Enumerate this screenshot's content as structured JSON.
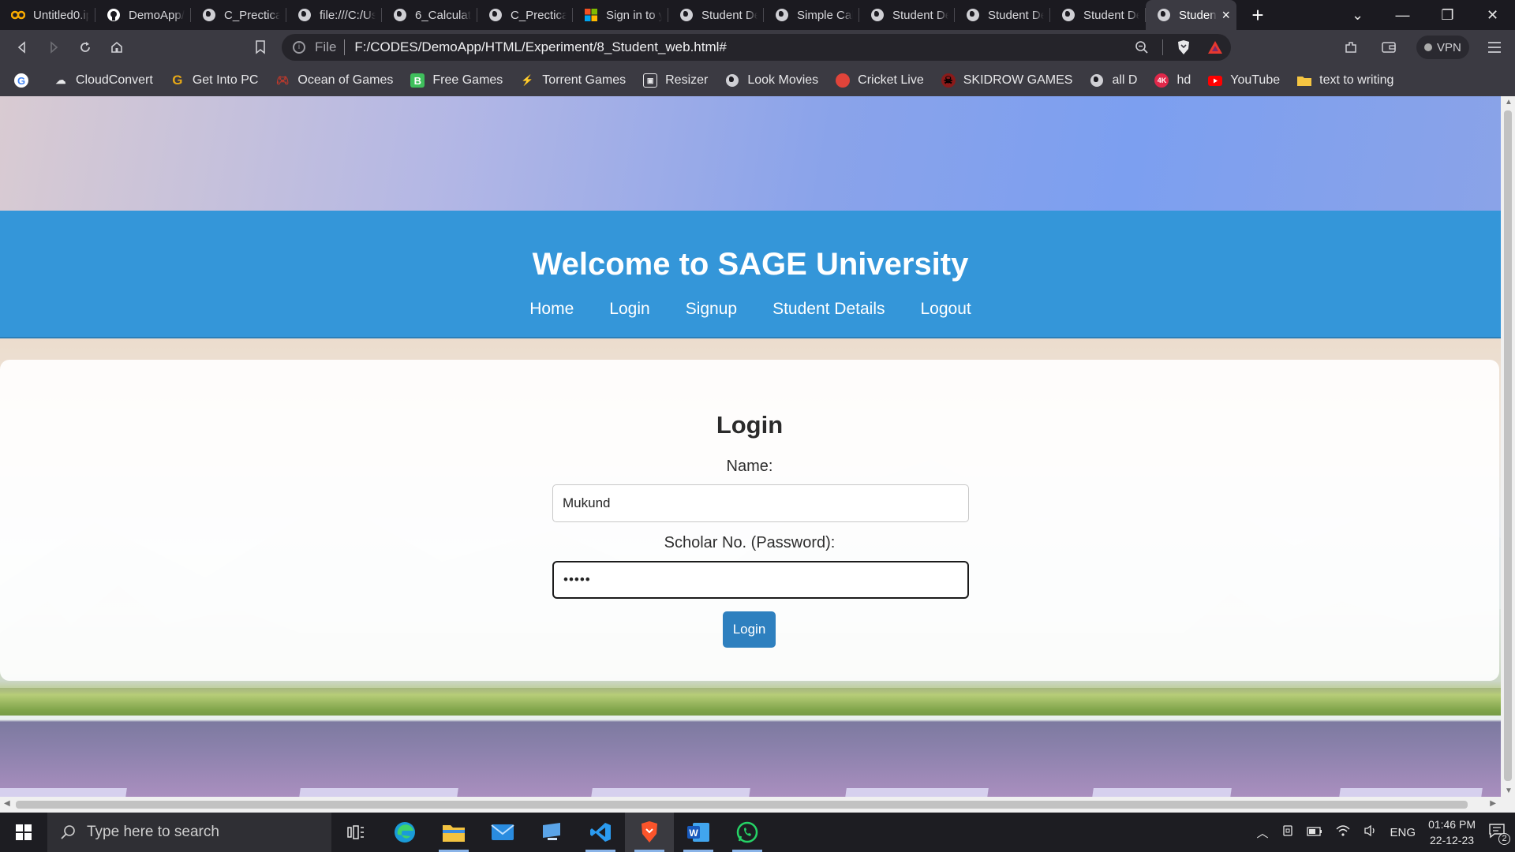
{
  "browser": {
    "tabs": [
      {
        "title": "Untitled0.ip",
        "icon": "colab-icon"
      },
      {
        "title": "DemoApp/",
        "icon": "github-icon"
      },
      {
        "title": "C_Prectical_",
        "icon": "globe-icon"
      },
      {
        "title": "file:///C:/Us",
        "icon": "globe-icon"
      },
      {
        "title": "6_Calculato",
        "icon": "globe-icon"
      },
      {
        "title": "C_Prectical_",
        "icon": "globe-icon"
      },
      {
        "title": "Sign in to y",
        "icon": "microsoft-icon"
      },
      {
        "title": "Student De",
        "icon": "globe-icon"
      },
      {
        "title": "Simple Calc",
        "icon": "globe-icon"
      },
      {
        "title": "Student De",
        "icon": "globe-icon"
      },
      {
        "title": "Student De",
        "icon": "globe-icon"
      },
      {
        "title": "Student De",
        "icon": "globe-icon"
      }
    ],
    "active_tab": {
      "title": "Studen",
      "close": "×"
    },
    "new_tab": "+",
    "address": {
      "scheme_label": "File",
      "url": "F:/CODES/DemoApp/HTML/Experiment/8_Student_web.html#"
    },
    "vpn_label": "VPN",
    "bookmarks": [
      {
        "label": "",
        "icon": "google-icon"
      },
      {
        "label": "CloudConvert",
        "icon": "cloudconvert-icon"
      },
      {
        "label": "Get Into PC",
        "icon": "getintopc-icon"
      },
      {
        "label": "Ocean of Games",
        "icon": "gamepad-icon"
      },
      {
        "label": "Free Games",
        "icon": "freegames-icon"
      },
      {
        "label": "Torrent Games",
        "icon": "torrent-icon"
      },
      {
        "label": "Resizer",
        "icon": "resizer-icon"
      },
      {
        "label": "Look Movies",
        "icon": "globe-icon"
      },
      {
        "label": "Cricket  Live",
        "icon": "cricket-icon"
      },
      {
        "label": "SKIDROW GAMES",
        "icon": "skidrow-icon"
      },
      {
        "label": "all D",
        "icon": "globe-icon"
      },
      {
        "label": "hd",
        "icon": "4k-icon"
      },
      {
        "label": "YouTube",
        "icon": "youtube-icon"
      },
      {
        "label": "text to writing",
        "icon": "folder-icon"
      }
    ]
  },
  "page": {
    "title": "Welcome to SAGE University",
    "nav": [
      "Home",
      "Login",
      "Signup",
      "Student Details",
      "Logout"
    ],
    "login": {
      "heading": "Login",
      "name_label": "Name:",
      "name_value": "Mukund",
      "password_label": "Scholar No. (Password):",
      "password_value": "•••••",
      "button": "Login"
    }
  },
  "taskbar": {
    "search_placeholder": "Type here to search",
    "language": "ENG",
    "time": "01:46 PM",
    "date": "22-12-23",
    "notifications": "2"
  },
  "colors": {
    "header_bg": "#3496d9",
    "login_button": "#2e80bf"
  }
}
